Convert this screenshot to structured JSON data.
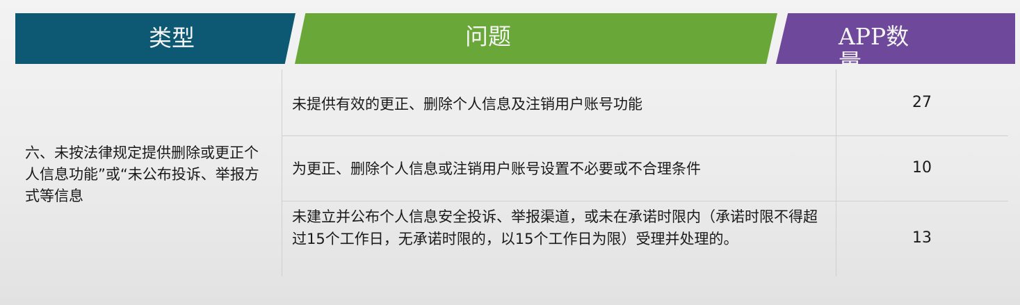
{
  "header": {
    "type_label": "类型",
    "issue_label": "问题",
    "count_label": "APP数量",
    "colors": {
      "type": "#0d5873",
      "issue": "#69a838",
      "count": "#6e499b"
    }
  },
  "category": {
    "text": "六、未按法律规定提供删除或更正个人信息功能”或“未公布投诉、举报方式等信息"
  },
  "rows": [
    {
      "issue": "未提供有效的更正、删除个人信息及注销用户账号功能",
      "count": "27"
    },
    {
      "issue": "为更正、删除个人信息或注销用户账号设置不必要或不合理条件",
      "count": "10"
    },
    {
      "issue": "未建立并公布个人信息安全投诉、举报渠道，或未在承诺时限内（承诺时限不得超过15个工作日，无承诺时限的，以15个工作日为限）受理并处理的。",
      "count": "13"
    }
  ]
}
